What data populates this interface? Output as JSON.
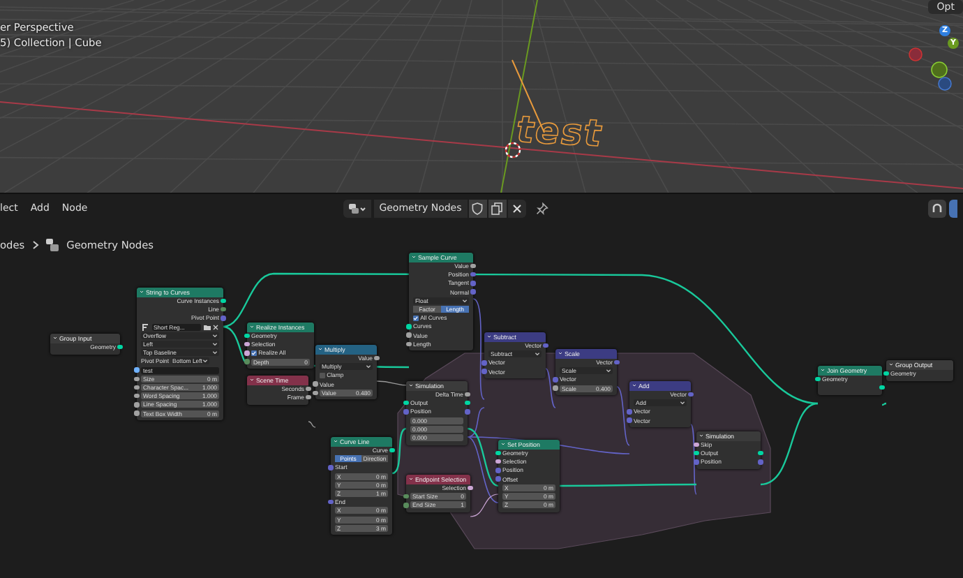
{
  "viewport": {
    "view_name": "er Perspective",
    "collection": "5) Collection | Cube",
    "object_text": "test",
    "options_button": "Opt",
    "gizmo": [
      {
        "label": "Z",
        "color": "#2f7fe0"
      },
      {
        "label": "Y",
        "color": "#6a9a20"
      }
    ]
  },
  "header": {
    "menus": [
      "lect",
      "Add",
      "Node"
    ],
    "datablock": "Geometry Nodes"
  },
  "breadcrumbs": [
    "odes",
    "Geometry Nodes"
  ],
  "nodes": [
    {
      "title": "Group Input",
      "color": "#3b3b3b",
      "rows": [
        {
          "kind": "output",
          "label": "Geometry",
          "color": "#00d6a3"
        }
      ]
    },
    {
      "title": "String to Curves",
      "color": "#1e7a63",
      "rows": [
        {
          "kind": "output",
          "label": "Curve Instances",
          "color": "#00d6a3"
        },
        {
          "kind": "output",
          "label": "Line",
          "color": "#598c5c"
        },
        {
          "kind": "output",
          "label": "Pivot Point",
          "color": "#6363c7"
        },
        {
          "kind": "font",
          "value": "Short Reg..."
        },
        {
          "kind": "dropdown",
          "value": "Overflow"
        },
        {
          "kind": "dropdown",
          "value": "Left"
        },
        {
          "kind": "dropdown",
          "value": "Top Baseline"
        },
        {
          "kind": "pair",
          "label": "Pivot Point",
          "value": "Bottom Left"
        },
        {
          "kind": "text",
          "value": "test",
          "color": "#70b2ff"
        },
        {
          "kind": "field",
          "label": "Size",
          "value": "0 m",
          "color": "#a1a1a1"
        },
        {
          "kind": "field",
          "label": "Character Spac...",
          "value": "1.000",
          "color": "#a1a1a1"
        },
        {
          "kind": "field",
          "label": "Word Spacing",
          "value": "1.000",
          "color": "#a1a1a1"
        },
        {
          "kind": "field",
          "label": "Line Spacing",
          "value": "1.000",
          "color": "#a1a1a1"
        },
        {
          "kind": "field",
          "label": "Text Box Width",
          "value": "0 m",
          "color": "#a1a1a1"
        }
      ]
    },
    {
      "title": "Realize Instances",
      "color": "#1e7a63",
      "rows": [
        {
          "kind": "input",
          "label": "Geometry",
          "color": "#00d6a3"
        },
        {
          "kind": "input",
          "label": "Selection",
          "color": "#cca6d6"
        },
        {
          "kind": "check",
          "label": "Realize All",
          "checked": true,
          "color": "#cca6d6"
        },
        {
          "kind": "field",
          "label": "Depth",
          "value": "0",
          "color": "#598c5c"
        }
      ]
    },
    {
      "title": "Scene Time",
      "color": "#83314a",
      "rows": [
        {
          "kind": "output",
          "label": "Seconds",
          "color": "#a1a1a1"
        },
        {
          "kind": "output",
          "label": "Frame",
          "color": "#a1a1a1"
        }
      ]
    },
    {
      "title": "Multiply",
      "color": "#246283",
      "rows": [
        {
          "kind": "output",
          "label": "Value",
          "color": "#a1a1a1"
        },
        {
          "kind": "dropdown",
          "value": "Multiply"
        },
        {
          "kind": "check",
          "label": "Clamp",
          "checked": false
        },
        {
          "kind": "input",
          "label": "Value",
          "color": "#a1a1a1"
        },
        {
          "kind": "field",
          "label": "Value",
          "value": "0.480",
          "color": "#a1a1a1"
        }
      ]
    },
    {
      "title": "Curve Line",
      "color": "#1e7a63",
      "rows": [
        {
          "kind": "output",
          "label": "Curve",
          "color": "#00d6a3"
        },
        {
          "kind": "toggle",
          "options": [
            {
              "label": "Points",
              "selected": true
            },
            {
              "label": "Direction",
              "selected": false
            }
          ]
        },
        {
          "kind": "input",
          "label": "Start",
          "color": "#6363c7"
        },
        {
          "kind": "field",
          "label": "X",
          "value": "0 m"
        },
        {
          "kind": "field",
          "label": "Y",
          "value": "0 m"
        },
        {
          "kind": "field",
          "label": "Z",
          "value": "1 m"
        },
        {
          "kind": "input",
          "label": "End",
          "color": "#6363c7"
        },
        {
          "kind": "field",
          "label": "X",
          "value": "0 m"
        },
        {
          "kind": "field",
          "label": "Y",
          "value": "0 m"
        },
        {
          "kind": "field",
          "label": "Z",
          "value": "3 m"
        }
      ]
    },
    {
      "title": "Sample Curve",
      "color": "#1e7a63",
      "rows": [
        {
          "kind": "output",
          "label": "Value",
          "color": "#a1a1a1"
        },
        {
          "kind": "output",
          "label": "Position",
          "color": "#6363c7"
        },
        {
          "kind": "output",
          "label": "Tangent",
          "color": "#6363c7"
        },
        {
          "kind": "output",
          "label": "Normal",
          "color": "#6363c7"
        },
        {
          "kind": "dropdown",
          "value": "Float"
        },
        {
          "kind": "toggle",
          "options": [
            {
              "label": "Factor",
              "selected": false
            },
            {
              "label": "Length",
              "selected": true
            }
          ]
        },
        {
          "kind": "check",
          "label": "All Curves",
          "checked": true
        },
        {
          "kind": "input",
          "label": "Curves",
          "color": "#00d6a3"
        },
        {
          "kind": "input",
          "label": "Value",
          "color": "#a1a1a1"
        },
        {
          "kind": "input",
          "label": "Length",
          "color": "#a1a1a1"
        }
      ]
    },
    {
      "title": "Simulation",
      "color": "#3b3b3b",
      "rows": [
        {
          "kind": "output",
          "label": "Delta Time",
          "color": "#a1a1a1"
        },
        {
          "kind": "both",
          "label": "Output",
          "color": "#00d6a3"
        },
        {
          "kind": "both",
          "label": "Position",
          "color": "#6363c7"
        },
        {
          "kind": "field",
          "value": "0.000"
        },
        {
          "kind": "field",
          "value": "0.000"
        },
        {
          "kind": "field",
          "value": "0.000"
        }
      ]
    },
    {
      "title": "Endpoint Selection",
      "color": "#83314a",
      "rows": [
        {
          "kind": "output",
          "label": "Selection",
          "color": "#cca6d6"
        },
        {
          "kind": "field",
          "label": "Start Size",
          "value": "0",
          "color": "#598c5c"
        },
        {
          "kind": "field",
          "label": "End Size",
          "value": "1",
          "color": "#598c5c"
        }
      ]
    },
    {
      "title": "Subtract",
      "color": "#3c3c83",
      "rows": [
        {
          "kind": "output",
          "label": "Vector",
          "color": "#6363c7"
        },
        {
          "kind": "dropdown",
          "value": "Subtract"
        },
        {
          "kind": "input",
          "label": "Vector",
          "color": "#6363c7"
        },
        {
          "kind": "input",
          "label": "Vector",
          "color": "#6363c7"
        }
      ]
    },
    {
      "title": "Set Position",
      "color": "#1e7a63",
      "rows": [
        {
          "kind": "input",
          "label": "Geometry",
          "color": "#00d6a3"
        },
        {
          "kind": "input",
          "label": "Selection",
          "color": "#cca6d6"
        },
        {
          "kind": "input",
          "label": "Position",
          "color": "#6363c7"
        },
        {
          "kind": "input",
          "label": "Offset",
          "color": "#6363c7"
        },
        {
          "kind": "field",
          "label": "X",
          "value": "0 m"
        },
        {
          "kind": "field",
          "label": "Y",
          "value": "0 m"
        },
        {
          "kind": "field",
          "label": "Z",
          "value": "0 m"
        }
      ]
    },
    {
      "title": "Scale",
      "color": "#3c3c83",
      "rows": [
        {
          "kind": "output",
          "label": "Vector",
          "color": "#6363c7"
        },
        {
          "kind": "dropdown",
          "value": "Scale"
        },
        {
          "kind": "input",
          "label": "Vector",
          "color": "#6363c7"
        },
        {
          "kind": "field",
          "label": "Scale",
          "value": "0.400",
          "color": "#a1a1a1"
        }
      ]
    },
    {
      "title": "Add",
      "color": "#3c3c83",
      "rows": [
        {
          "kind": "output",
          "label": "Vector",
          "color": "#6363c7"
        },
        {
          "kind": "dropdown",
          "value": "Add"
        },
        {
          "kind": "input",
          "label": "Vector",
          "color": "#6363c7"
        },
        {
          "kind": "input",
          "label": "Vector",
          "color": "#6363c7"
        }
      ]
    },
    {
      "title": "Simulation",
      "color": "#3b3b3b",
      "rows": [
        {
          "kind": "input",
          "label": "Skip",
          "color": "#cca6d6"
        },
        {
          "kind": "both",
          "label": "Output",
          "color": "#00d6a3"
        },
        {
          "kind": "both",
          "label": "Position",
          "color": "#6363c7"
        }
      ]
    },
    {
      "title": "Join Geometry",
      "color": "#1e7a63",
      "rows": [
        {
          "kind": "input",
          "label": "Geometry",
          "color": "#00d6a3"
        },
        {
          "kind": "output",
          "label": "",
          "color": "#00d6a3"
        }
      ]
    },
    {
      "title": "Group Output",
      "color": "#3b3b3b",
      "rows": [
        {
          "kind": "input",
          "label": "Geometry",
          "color": "#00d6a3"
        }
      ]
    }
  ]
}
